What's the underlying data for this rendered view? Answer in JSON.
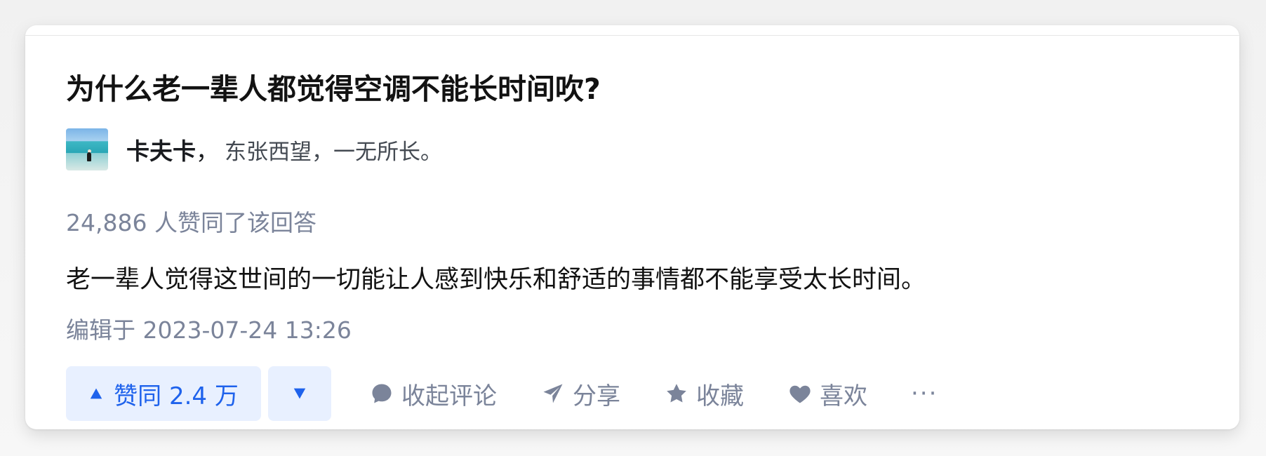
{
  "question": {
    "title": "为什么老一辈人都觉得空调不能长时间吹?"
  },
  "author": {
    "name": "卡夫卡",
    "separator": "，",
    "description": "东张西望，一无所长。"
  },
  "answer": {
    "votes_text": "24,886 人赞同了该回答",
    "content": "老一辈人觉得这世间的一切能让人感到快乐和舒适的事情都不能享受太长时间。",
    "edited_text": "编辑于 2023-07-24 13:26"
  },
  "actions": {
    "upvote_label": "赞同 2.4 万",
    "comment_label": "收起评论",
    "share_label": "分享",
    "favorite_label": "收藏",
    "like_label": "喜欢",
    "more_label": "···"
  },
  "colors": {
    "primary": "#1e62ec",
    "primary_bg": "#e8f0ff",
    "meta_text": "#7b849a",
    "body_text": "#121212"
  },
  "icons": {
    "upvote": "triangle-up-icon",
    "downvote": "triangle-down-icon",
    "comment": "comment-bubble-icon",
    "share": "paper-plane-icon",
    "favorite": "star-icon",
    "like": "heart-icon",
    "more": "ellipsis-icon"
  }
}
